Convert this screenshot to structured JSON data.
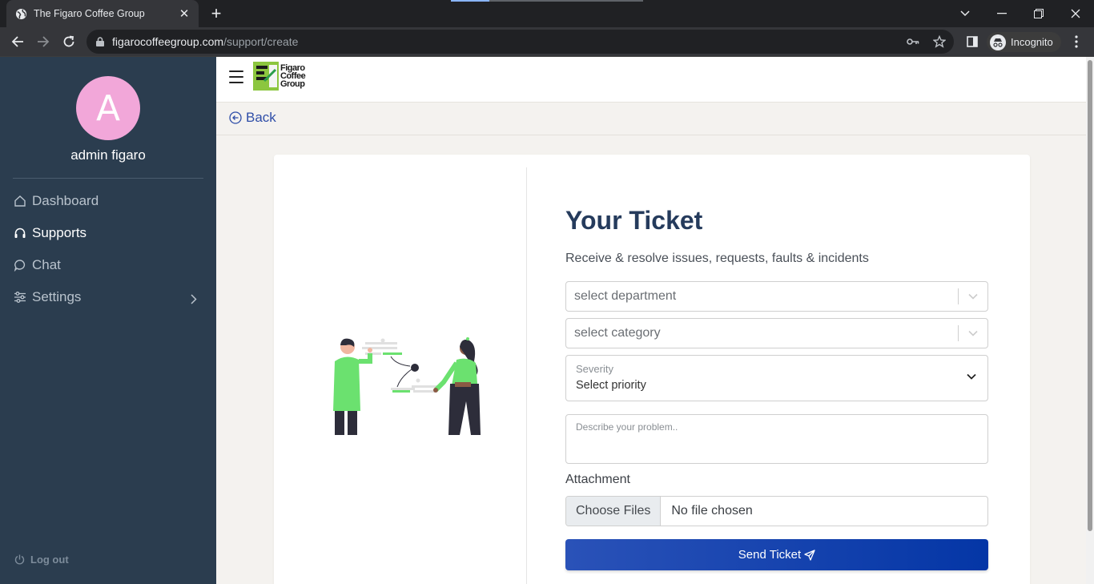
{
  "browser": {
    "tab_title": "The Figaro Coffee Group",
    "url_host": "figarocoffeegroup.com",
    "url_path": "/support/create",
    "profile_label": "Incognito"
  },
  "sidebar": {
    "avatar_initial": "A",
    "user_name": "admin figaro",
    "items": [
      {
        "label": "Dashboard",
        "icon": "home-icon"
      },
      {
        "label": "Supports",
        "icon": "headset-icon"
      },
      {
        "label": "Chat",
        "icon": "chat-bubble-icon"
      },
      {
        "label": "Settings",
        "icon": "sliders-icon"
      }
    ],
    "logout_label": "Log out"
  },
  "header": {
    "logo_text_line1": "Figaro",
    "logo_text_line2": "Coffee",
    "logo_text_line3": "Group",
    "back_label": "Back"
  },
  "form": {
    "title": "Your Ticket",
    "subtitle": "Receive & resolve issues, requests, faults & incidents",
    "department_placeholder": "select department",
    "category_placeholder": "select category",
    "severity_label": "Severity",
    "severity_value": "Select priority",
    "description_placeholder": "Describe your problem..",
    "attachment_label": "Attachment",
    "choose_files_label": "Choose Files",
    "no_file_label": "No file chosen",
    "submit_label": "Send Ticket"
  },
  "colors": {
    "sidebar_bg": "#2b3d4f",
    "avatar_bg": "#f2a7d9",
    "title": "#253b5c",
    "accent_blue": "#0436a6",
    "illustration_green": "#6be16f"
  }
}
